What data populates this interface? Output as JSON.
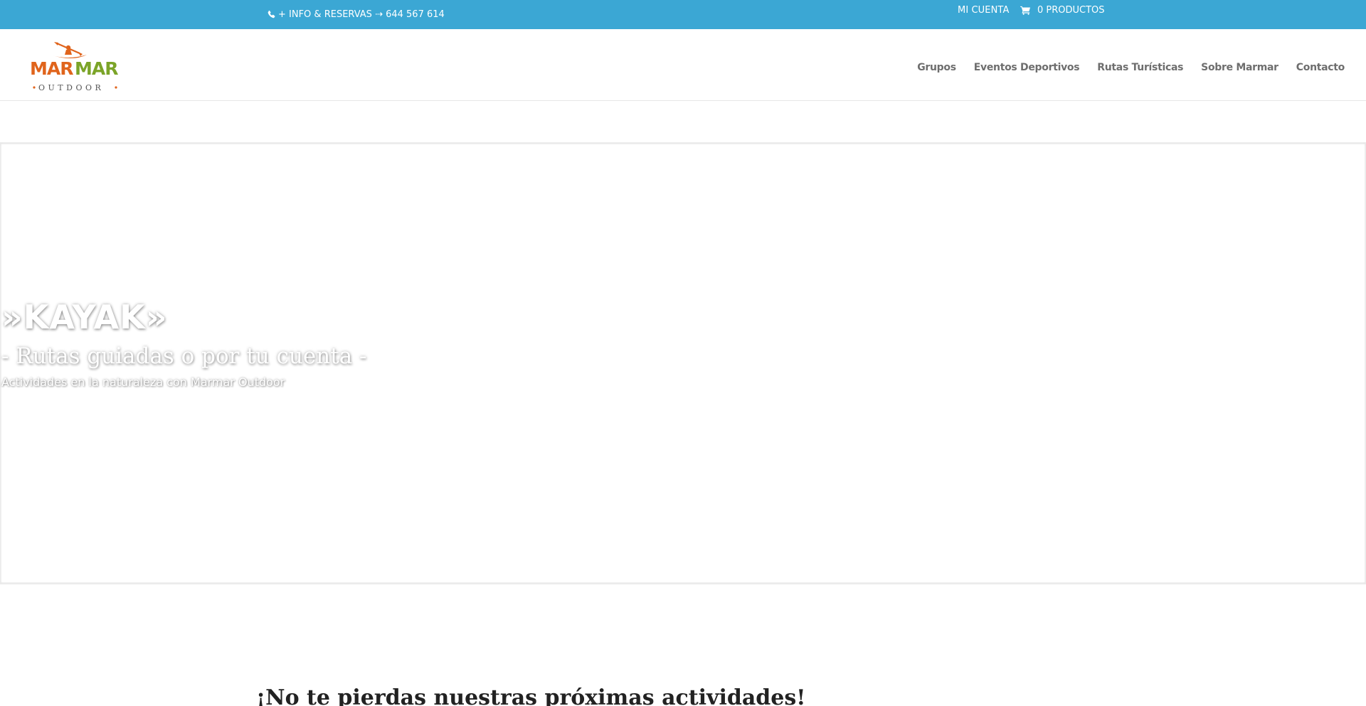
{
  "topbar": {
    "phone_text": "+ INFO & RESERVAS ⇢ 644 567 614",
    "account_label": "MI CUENTA",
    "cart_label": "0 PRODUCTOS",
    "background_color": "#3ba7d4"
  },
  "header": {
    "logo": {
      "word": "MARMAR",
      "sub": "OUTDOOR",
      "primary_color": "#e0641c",
      "secondary_color": "#7ba428"
    },
    "nav": [
      {
        "label": "Grupos"
      },
      {
        "label": "Eventos Deportivos"
      },
      {
        "label": "Rutas Turísticas"
      },
      {
        "label": "Sobre Marmar"
      },
      {
        "label": "Contacto"
      }
    ]
  },
  "hero": {
    "title": "»KAYAK»",
    "subtitle": "- Rutas guiadas o por tu cuenta -",
    "tagline": "Actividades en la naturaleza con Marmar Outdoor"
  },
  "section": {
    "heading": "¡No te pierdas nuestras próximas actividades!"
  },
  "icons": {
    "phone": "phone-icon",
    "cart": "cart-icon"
  }
}
